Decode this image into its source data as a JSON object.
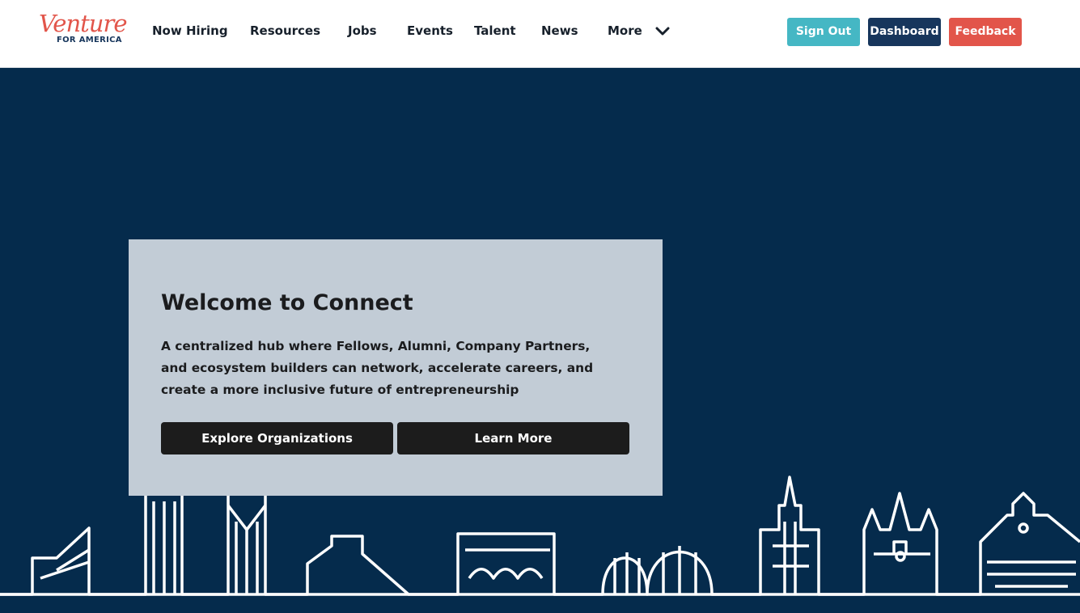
{
  "header": {
    "logo": {
      "script": "Venture",
      "sub": "FOR AMERICA"
    },
    "nav": [
      {
        "label": "Now Hiring"
      },
      {
        "label": "Resources"
      },
      {
        "label": "Jobs"
      },
      {
        "label": "Events"
      },
      {
        "label": "Talent"
      },
      {
        "label": "News"
      },
      {
        "label": "More"
      }
    ],
    "more_icon": "chevron-down-icon",
    "buttons": {
      "sign_out": "Sign Out",
      "dashboard": "Dashboard",
      "feedback": "Feedback"
    }
  },
  "colors": {
    "brand_red": "#e2554a",
    "navy": "#052b4c",
    "teal": "#45b7c4",
    "dark_navy": "#17365c",
    "card_bg": "#c2ccd6"
  },
  "hero": {
    "title": "Welcome to Connect",
    "description": "A centralized hub where Fellows, Alumni, Company Partners, and ecosystem builders can network, accelerate careers, and create a more inclusive future of entrepreneurship",
    "buttons": {
      "explore": "Explore Organizations",
      "learn": "Learn More"
    }
  }
}
